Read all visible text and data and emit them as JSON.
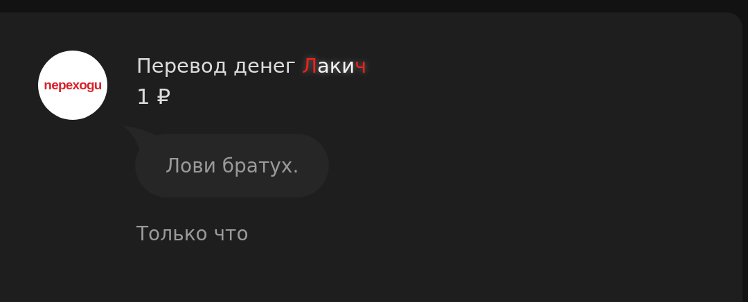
{
  "avatar": {
    "logo": "nepexogu"
  },
  "title": [
    {
      "text": "Перевод денег ",
      "highlight": false
    },
    {
      "text": "Л",
      "highlight": true
    },
    {
      "text": "аки",
      "highlight": false
    },
    {
      "text": "ч",
      "highlight": true
    }
  ],
  "amount": "1 ₽",
  "message": "Лови братух.",
  "time": "Только что"
}
